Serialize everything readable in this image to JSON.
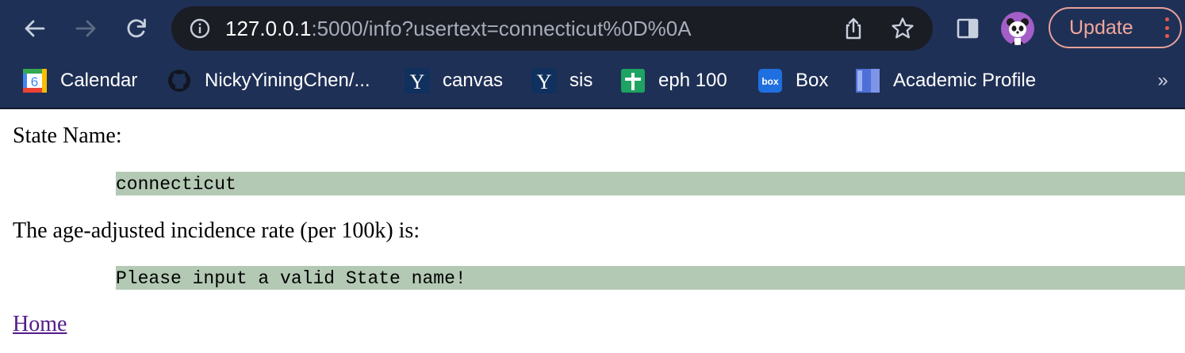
{
  "browser": {
    "url_host": "127.0.0.1",
    "url_rest": ":5000/info?usertext=connecticut%0D%0A",
    "update_label": "Update"
  },
  "bookmarks": [
    {
      "label": "Calendar",
      "icon": "google-calendar-icon",
      "icon_text": "6"
    },
    {
      "label": "NickyYiningChen/...",
      "icon": "github-icon"
    },
    {
      "label": "canvas",
      "icon": "yale-icon",
      "icon_text": "Y"
    },
    {
      "label": "sis",
      "icon": "yale-icon",
      "icon_text": "Y"
    },
    {
      "label": "eph 100",
      "icon": "google-sheets-icon"
    },
    {
      "label": "Box",
      "icon": "box-icon",
      "icon_text": "box"
    },
    {
      "label": "Academic Profile",
      "icon": "document-icon"
    }
  ],
  "bookmarks_overflow": "»",
  "page": {
    "state_label": "State Name:",
    "state_value": "connecticut",
    "rate_label": "The age-adjusted incidence rate (per 100k) is:",
    "rate_value": "Please input a valid State name!",
    "home_link": "Home"
  },
  "colors": {
    "chrome_bg": "#1f3056",
    "omnibox_bg": "#1a1d24",
    "code_bg": "#b3c9b4",
    "visited_link": "#551a8b",
    "update_accent": "#f1a79c"
  }
}
